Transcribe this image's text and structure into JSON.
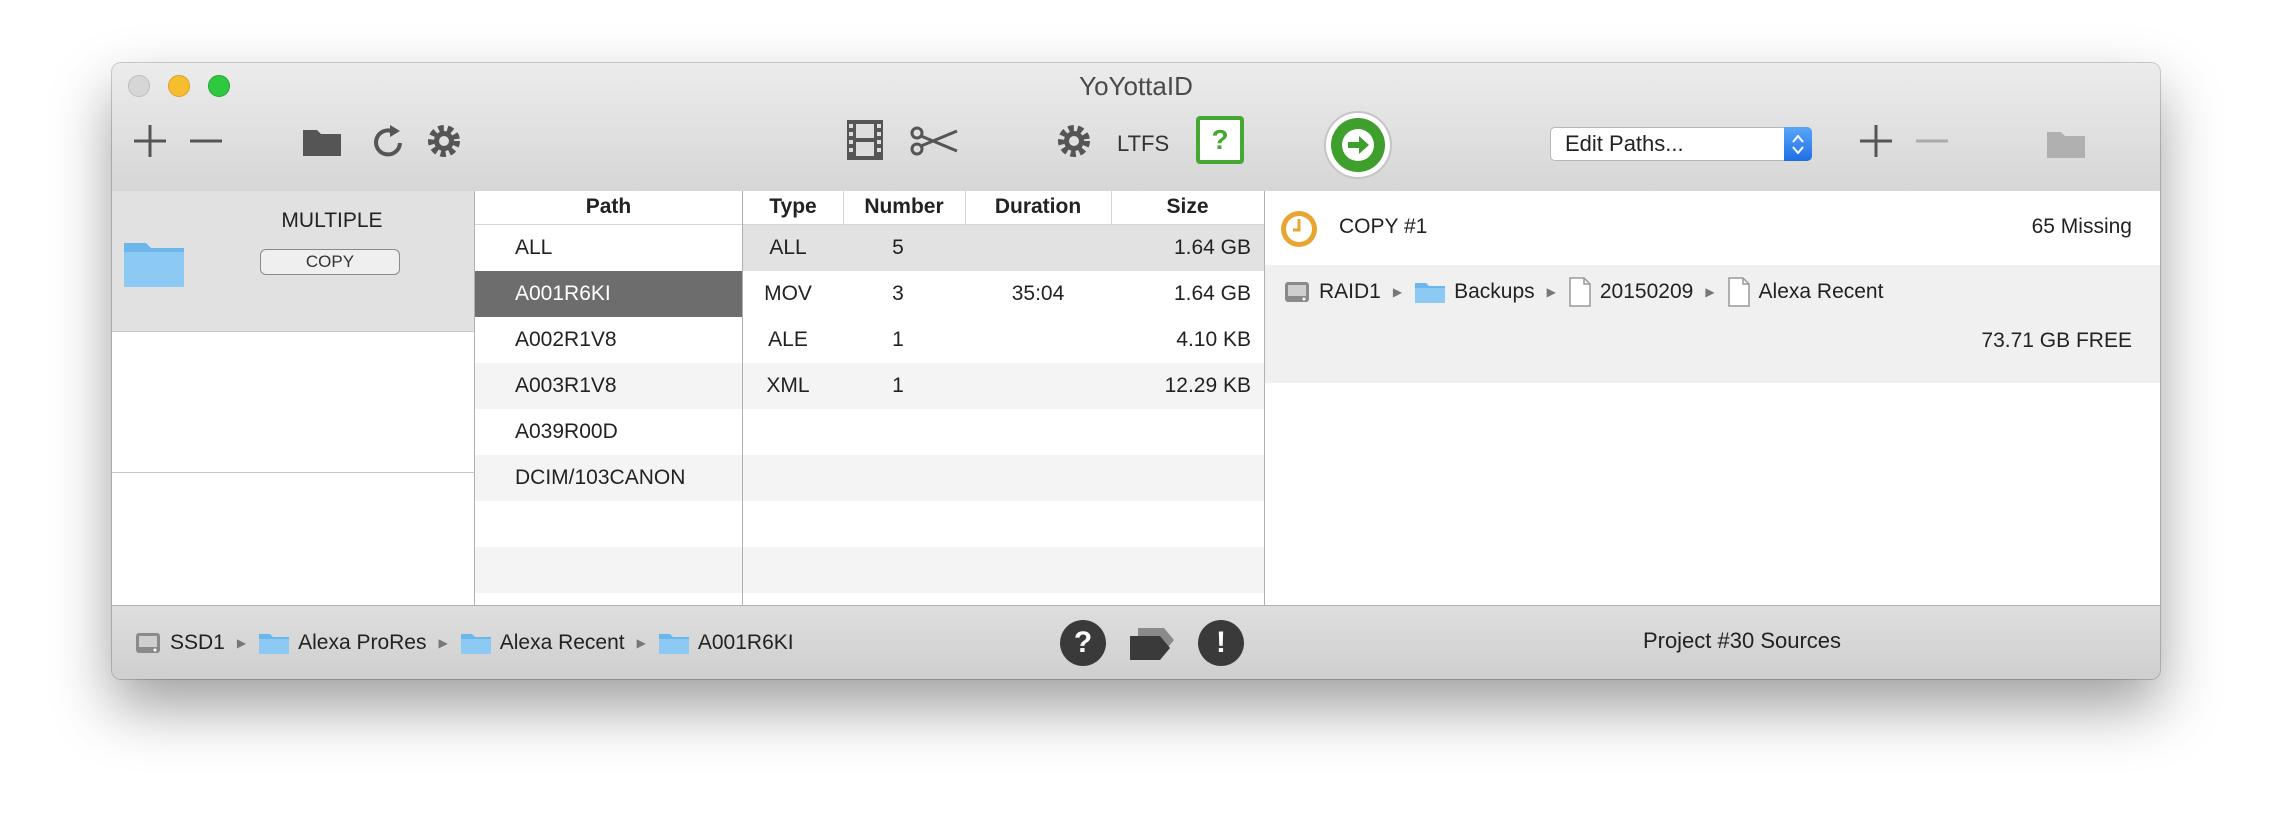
{
  "window": {
    "title": "YoYottaID"
  },
  "toolbar": {
    "ltfs_label": "LTFS",
    "help_label": "?",
    "edit_paths_value": "Edit Paths..."
  },
  "sources": {
    "items": [
      {
        "label": "MULTIPLE",
        "badge": "COPY"
      }
    ]
  },
  "paths": {
    "header": "Path",
    "items": [
      "ALL",
      "A001R6KI",
      "A002R1V8",
      "A003R1V8",
      "A039R00D",
      "DCIM/103CANON"
    ],
    "selected_index": 1
  },
  "types": {
    "headers": {
      "type": "Type",
      "number": "Number",
      "duration": "Duration",
      "size": "Size"
    },
    "rows": [
      {
        "type": "ALL",
        "number": "5",
        "duration": "",
        "size": "1.64 GB"
      },
      {
        "type": "MOV",
        "number": "3",
        "duration": "35:04",
        "size": "1.64 GB"
      },
      {
        "type": "ALE",
        "number": "1",
        "duration": "",
        "size": "4.10 KB"
      },
      {
        "type": "XML",
        "number": "1",
        "duration": "",
        "size": "12.29 KB"
      }
    ]
  },
  "destination": {
    "copy_label": "COPY #1",
    "missing": "65 Missing",
    "path": [
      "RAID1",
      "Backups",
      "20150209",
      "Alexa Recent"
    ],
    "free": "73.71 GB FREE"
  },
  "status": {
    "source_path": [
      "SSD1",
      "Alexa ProRes",
      "Alexa Recent",
      "A001R6KI"
    ],
    "help_label": "?",
    "alert_label": "!",
    "project": "Project #30 Sources"
  }
}
